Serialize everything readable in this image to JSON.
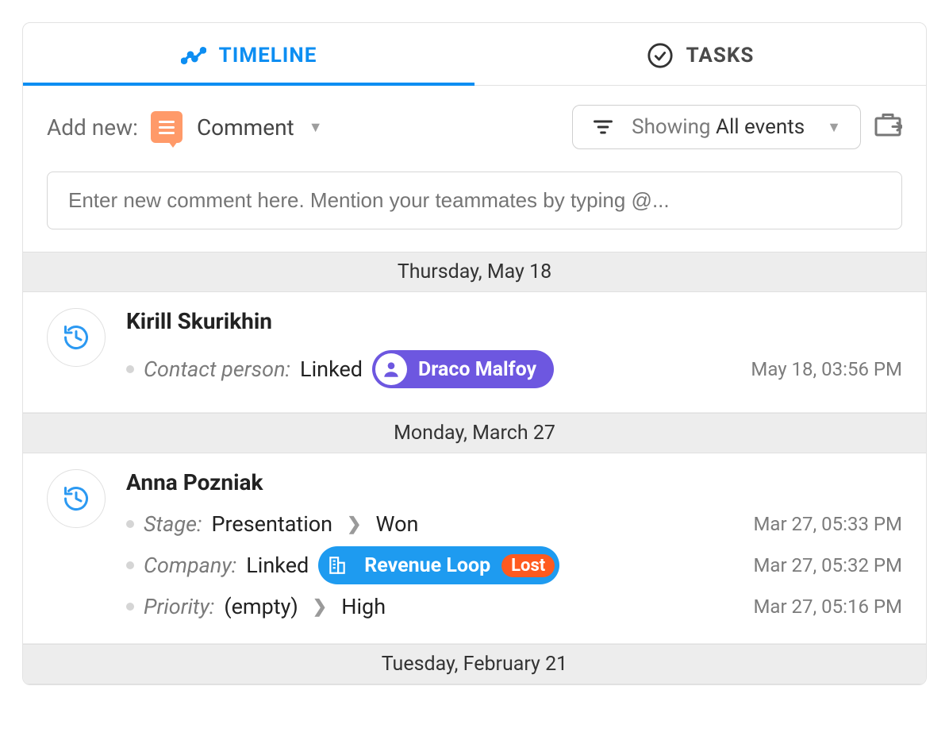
{
  "tabs": {
    "timeline": "TIMELINE",
    "tasks": "TASKS"
  },
  "toolbar": {
    "add_new_label": "Add new:",
    "add_type": "Comment",
    "filter_showing": "Showing",
    "filter_value": "All events"
  },
  "comment_input": {
    "placeholder": "Enter new comment here. Mention your teammates by typing @..."
  },
  "groups": [
    {
      "date": "Thursday, May 18",
      "entries": [
        {
          "user": "Kirill Skurikhin",
          "rows": [
            {
              "type": "contact_link",
              "field": "Contact person:",
              "action": "Linked",
              "pill_label": "Draco Malfoy",
              "timestamp": "May 18, 03:56 PM"
            }
          ]
        }
      ]
    },
    {
      "date": "Monday, March 27",
      "entries": [
        {
          "user": "Anna Pozniak",
          "rows": [
            {
              "type": "transition",
              "field": "Stage:",
              "from": "Presentation",
              "to": "Won",
              "timestamp": "Mar 27, 05:33 PM"
            },
            {
              "type": "company_link",
              "field": "Company:",
              "action": "Linked",
              "pill_label": "Revenue Loop",
              "badge": "Lost",
              "timestamp": "Mar 27, 05:32 PM"
            },
            {
              "type": "transition",
              "field": "Priority:",
              "from": "(empty)",
              "to": "High",
              "timestamp": "Mar 27, 05:16 PM"
            }
          ]
        }
      ]
    },
    {
      "date": "Tuesday, February 21",
      "entries": []
    }
  ]
}
